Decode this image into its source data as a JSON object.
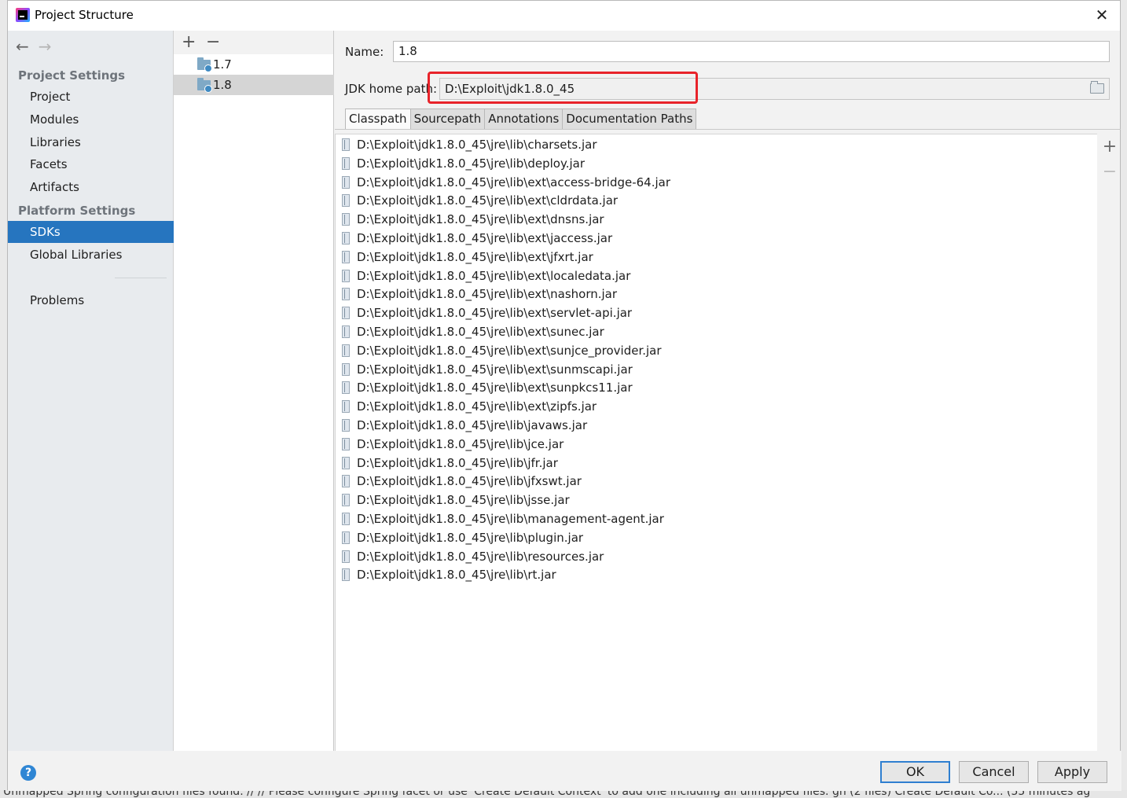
{
  "background": {
    "status_text": "Unmapped Spring configuration files found. // // Please configure Spring facet or use 'Create Default Context' to add one including all unmapped files. gh (2 files)  Create Default Co... (55 minutes ag"
  },
  "window": {
    "title": "Project Structure",
    "close_glyph": "✕"
  },
  "nav": {
    "back_glyph": "←",
    "forward_glyph": "→",
    "project_settings_header": "Project Settings",
    "project_items": [
      {
        "label": "Project"
      },
      {
        "label": "Modules"
      },
      {
        "label": "Libraries"
      },
      {
        "label": "Facets"
      },
      {
        "label": "Artifacts"
      }
    ],
    "platform_settings_header": "Platform Settings",
    "platform_items": [
      {
        "label": "SDKs",
        "selected": true
      },
      {
        "label": "Global Libraries"
      }
    ],
    "problems_label": "Problems"
  },
  "sdk_list": {
    "add_glyph": "+",
    "remove_glyph": "−",
    "items": [
      {
        "label": "1.7"
      },
      {
        "label": "1.8",
        "selected": true
      }
    ]
  },
  "sdk_detail": {
    "name_label": "Name:",
    "name_value": "1.8",
    "jdk_home_label": "JDK home path:",
    "jdk_home_value": "D:\\Exploit\\jdk1.8.0_45",
    "highlight_color": "#e8232a",
    "tabs": [
      {
        "label": "Classpath",
        "active": true
      },
      {
        "label": "Sourcepath"
      },
      {
        "label": "Annotations"
      },
      {
        "label": "Documentation Paths"
      }
    ],
    "side_add_glyph": "+",
    "side_remove_glyph": "−",
    "classpath": [
      "D:\\Exploit\\jdk1.8.0_45\\jre\\lib\\charsets.jar",
      "D:\\Exploit\\jdk1.8.0_45\\jre\\lib\\deploy.jar",
      "D:\\Exploit\\jdk1.8.0_45\\jre\\lib\\ext\\access-bridge-64.jar",
      "D:\\Exploit\\jdk1.8.0_45\\jre\\lib\\ext\\cldrdata.jar",
      "D:\\Exploit\\jdk1.8.0_45\\jre\\lib\\ext\\dnsns.jar",
      "D:\\Exploit\\jdk1.8.0_45\\jre\\lib\\ext\\jaccess.jar",
      "D:\\Exploit\\jdk1.8.0_45\\jre\\lib\\ext\\jfxrt.jar",
      "D:\\Exploit\\jdk1.8.0_45\\jre\\lib\\ext\\localedata.jar",
      "D:\\Exploit\\jdk1.8.0_45\\jre\\lib\\ext\\nashorn.jar",
      "D:\\Exploit\\jdk1.8.0_45\\jre\\lib\\ext\\servlet-api.jar",
      "D:\\Exploit\\jdk1.8.0_45\\jre\\lib\\ext\\sunec.jar",
      "D:\\Exploit\\jdk1.8.0_45\\jre\\lib\\ext\\sunjce_provider.jar",
      "D:\\Exploit\\jdk1.8.0_45\\jre\\lib\\ext\\sunmscapi.jar",
      "D:\\Exploit\\jdk1.8.0_45\\jre\\lib\\ext\\sunpkcs11.jar",
      "D:\\Exploit\\jdk1.8.0_45\\jre\\lib\\ext\\zipfs.jar",
      "D:\\Exploit\\jdk1.8.0_45\\jre\\lib\\javaws.jar",
      "D:\\Exploit\\jdk1.8.0_45\\jre\\lib\\jce.jar",
      "D:\\Exploit\\jdk1.8.0_45\\jre\\lib\\jfr.jar",
      "D:\\Exploit\\jdk1.8.0_45\\jre\\lib\\jfxswt.jar",
      "D:\\Exploit\\jdk1.8.0_45\\jre\\lib\\jsse.jar",
      "D:\\Exploit\\jdk1.8.0_45\\jre\\lib\\management-agent.jar",
      "D:\\Exploit\\jdk1.8.0_45\\jre\\lib\\plugin.jar",
      "D:\\Exploit\\jdk1.8.0_45\\jre\\lib\\resources.jar",
      "D:\\Exploit\\jdk1.8.0_45\\jre\\lib\\rt.jar"
    ]
  },
  "footer": {
    "help_glyph": "?",
    "ok_label": "OK",
    "cancel_label": "Cancel",
    "apply_label": "Apply"
  }
}
